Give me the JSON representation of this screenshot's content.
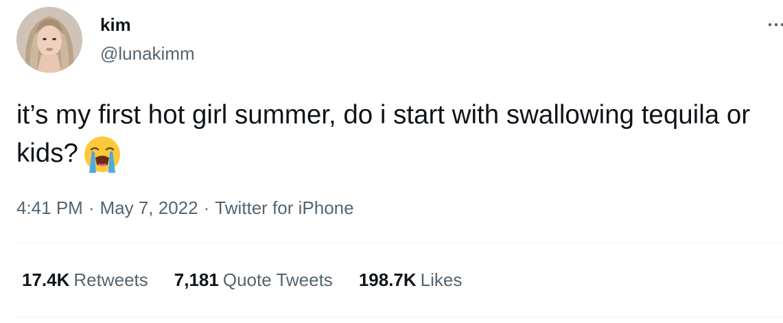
{
  "author": {
    "display_name": "kim",
    "handle": "@lunakimm",
    "avatar_icon": "profile-photo"
  },
  "tweet": {
    "text": "it’s my first hot girl summer, do i start with swallowing tequila or kids?",
    "emoji_icon": "loudly-crying-face-icon"
  },
  "meta": {
    "time": "4:41 PM",
    "date": "May 7, 2022",
    "source": "Twitter for iPhone",
    "separator": "·"
  },
  "stats": {
    "retweets_count": "17.4K",
    "retweets_label": "Retweets",
    "quotes_count": "7,181",
    "quotes_label": "Quote Tweets",
    "likes_count": "198.7K",
    "likes_label": "Likes"
  },
  "colors": {
    "text_primary": "#0f1419",
    "text_secondary": "#536471",
    "divider": "#eff3f4"
  }
}
